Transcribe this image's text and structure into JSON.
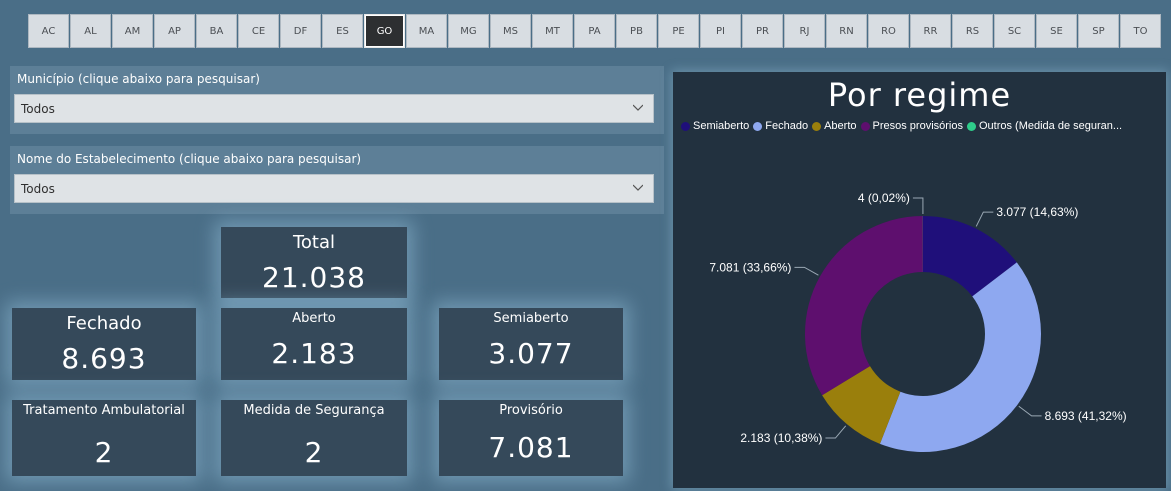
{
  "states": {
    "items": [
      "AC",
      "AL",
      "AM",
      "AP",
      "BA",
      "CE",
      "DF",
      "ES",
      "GO",
      "MA",
      "MG",
      "MS",
      "MT",
      "PA",
      "PB",
      "PE",
      "PI",
      "PR",
      "RJ",
      "RN",
      "RO",
      "RR",
      "RS",
      "SC",
      "SE",
      "SP",
      "TO"
    ],
    "selected": "GO"
  },
  "filters": {
    "municipio": {
      "title": "Município (clique abaixo para pesquisar)",
      "value": "Todos"
    },
    "estabelecimento": {
      "title": "Nome do Estabelecimento (clique abaixo para pesquisar)",
      "value": "Todos"
    }
  },
  "cards": {
    "total": {
      "label": "Total",
      "value": "21.038"
    },
    "fechado": {
      "label": "Fechado",
      "value": "8.693"
    },
    "aberto": {
      "label": "Aberto",
      "value": "2.183"
    },
    "semiaberto": {
      "label": "Semiaberto",
      "value": "3.077"
    },
    "tratamento": {
      "label": "Tratamento Ambulatorial",
      "value": "2"
    },
    "medida": {
      "label": "Medida de Segurança",
      "value": "2"
    },
    "provisorio": {
      "label": "Provisório",
      "value": "7.081"
    }
  },
  "chart_data": {
    "type": "pie",
    "title": "Por regime",
    "legend_position": "top",
    "legend": [
      "Semiaberto",
      "Fechado",
      "Aberto",
      "Presos provisórios",
      "Outros (Medida de seguran..."
    ],
    "slices": [
      {
        "name": "Semiaberto",
        "value": 3077,
        "label": "3.077 (14,63%)",
        "color": "#1f0f7a"
      },
      {
        "name": "Fechado",
        "value": 8693,
        "label": "8.693 (41,32%)",
        "color": "#8ea8f0"
      },
      {
        "name": "Aberto",
        "value": 2183,
        "label": "2.183 (10,38%)",
        "color": "#9a7f0c"
      },
      {
        "name": "Presos provisórios",
        "value": 7081,
        "label": "7.081 (33,66%)",
        "color": "#5e0f6e"
      },
      {
        "name": "Outros (Medida de seguran...",
        "value": 4,
        "label": "4 (0,02%)",
        "color": "#2ecc8a"
      }
    ]
  }
}
